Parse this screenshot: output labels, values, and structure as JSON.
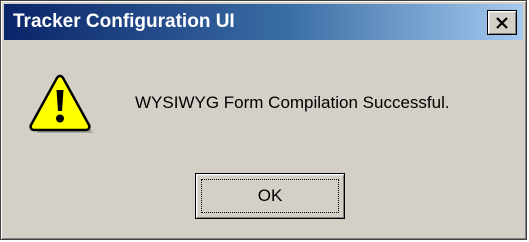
{
  "window": {
    "title": "Tracker Configuration UI"
  },
  "titlebar": {
    "close_icon": "close-icon",
    "colors": {
      "active_start": "#0a246a",
      "active_end": "#a6caf0"
    }
  },
  "dialog": {
    "icon": "warning-icon",
    "message": "WYSIWYG Form Compilation Successful.",
    "ok_label": "OK",
    "background": "#d4d0c8"
  }
}
